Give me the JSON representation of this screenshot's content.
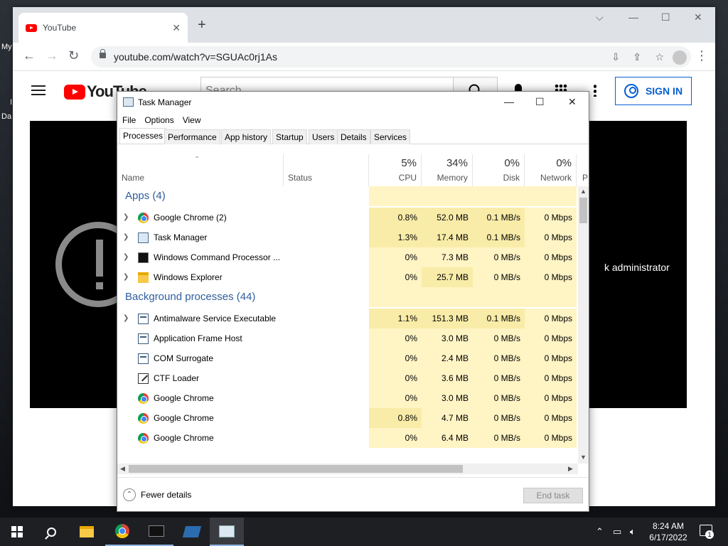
{
  "desktop": {
    "label_my": "My",
    "label_d": "I",
    "label_da": "Da"
  },
  "chrome": {
    "tab_title": "YouTube",
    "tab_close": "✕",
    "new_tab": "+",
    "minimize": "—",
    "restore": "☐",
    "close": "✕",
    "chevron": "⌵",
    "back": "←",
    "forward": "→",
    "reload": "↻",
    "url": "youtube.com/watch?v=SGUAc0rj1As",
    "install_icon": "⇩",
    "share_icon": "⇪",
    "star_icon": "☆",
    "menu_icon": "⋮"
  },
  "youtube": {
    "search_placeholder": "Search",
    "sign_in": "SIGN IN",
    "logo_text": "YouTube",
    "player_text": "k administrator"
  },
  "task_manager": {
    "title": "Task Manager",
    "menu": [
      "File",
      "Options",
      "View"
    ],
    "tabs": [
      "Processes",
      "Performance",
      "App history",
      "Startup",
      "Users",
      "Details",
      "Services"
    ],
    "columns": {
      "name": "Name",
      "status": "Status",
      "cpu": {
        "pct": "5%",
        "label": "CPU"
      },
      "memory": {
        "pct": "34%",
        "label": "Memory"
      },
      "disk": {
        "pct": "0%",
        "label": "Disk"
      },
      "network": {
        "pct": "0%",
        "label": "Network"
      },
      "power": "P"
    },
    "groups": {
      "apps": "Apps (4)",
      "background": "Background processes (44)"
    },
    "apps": [
      {
        "name": "Google Chrome (2)",
        "cpu": "0.8%",
        "memory": "52.0 MB",
        "disk": "0.1 MB/s",
        "network": "0 Mbps",
        "icon": "chrome-icon"
      },
      {
        "name": "Task Manager",
        "cpu": "1.3%",
        "memory": "17.4 MB",
        "disk": "0.1 MB/s",
        "network": "0 Mbps",
        "icon": "task-manager-icon"
      },
      {
        "name": "Windows Command Processor ...",
        "cpu": "0%",
        "memory": "7.3 MB",
        "disk": "0 MB/s",
        "network": "0 Mbps",
        "icon": "cmd-icon"
      },
      {
        "name": "Windows Explorer",
        "cpu": "0%",
        "memory": "25.7 MB",
        "disk": "0 MB/s",
        "network": "0 Mbps",
        "icon": "folder-icon"
      }
    ],
    "background": [
      {
        "name": "Antimalware Service Executable",
        "cpu": "1.1%",
        "memory": "151.3 MB",
        "disk": "0.1 MB/s",
        "network": "0 Mbps",
        "icon": "service-icon"
      },
      {
        "name": "Application Frame Host",
        "cpu": "0%",
        "memory": "3.0 MB",
        "disk": "0 MB/s",
        "network": "0 Mbps",
        "icon": "service-icon"
      },
      {
        "name": "COM Surrogate",
        "cpu": "0%",
        "memory": "2.4 MB",
        "disk": "0 MB/s",
        "network": "0 Mbps",
        "icon": "service-icon"
      },
      {
        "name": "CTF Loader",
        "cpu": "0%",
        "memory": "3.6 MB",
        "disk": "0 MB/s",
        "network": "0 Mbps",
        "icon": "ctf-loader-icon"
      },
      {
        "name": "Google Chrome",
        "cpu": "0%",
        "memory": "3.0 MB",
        "disk": "0 MB/s",
        "network": "0 Mbps",
        "icon": "chrome-icon"
      },
      {
        "name": "Google Chrome",
        "cpu": "0.8%",
        "memory": "4.7 MB",
        "disk": "0 MB/s",
        "network": "0 Mbps",
        "icon": "chrome-icon"
      },
      {
        "name": "Google Chrome",
        "cpu": "0%",
        "memory": "6.4 MB",
        "disk": "0 MB/s",
        "network": "0 Mbps",
        "icon": "chrome-icon"
      }
    ],
    "fewer_details": "Fewer details",
    "end_task": "End task"
  },
  "taskbar": {
    "time": "8:24 AM",
    "date": "6/17/2022",
    "notification_count": "1"
  },
  "colors": {
    "accent": "#065fd4",
    "group": "#2f5e9e",
    "heat_light": "#fff4c4",
    "heat_mid": "#f9eca8"
  }
}
